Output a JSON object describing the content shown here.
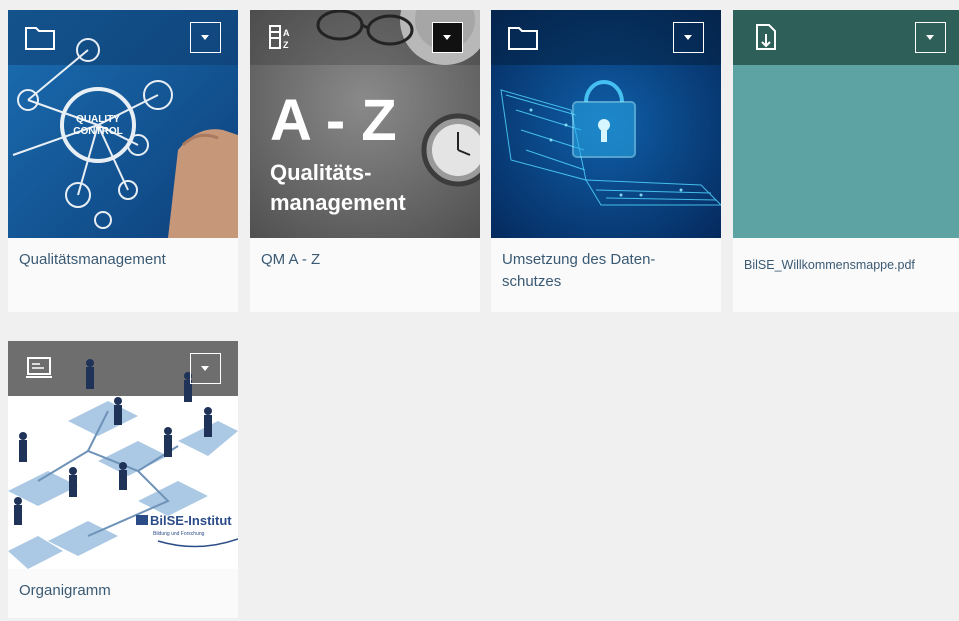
{
  "tiles": [
    {
      "title": "Qualitätsmanagement",
      "type_icon": "folder-icon",
      "image_text": [
        "QUALITY",
        "CONTROL"
      ]
    },
    {
      "title": "QM A - Z",
      "type_icon": "sort-a-z-icon",
      "image_text": [
        "A - Z",
        "Qualitäts-",
        "management"
      ]
    },
    {
      "title": "Umsetzung des Daten- schutzes",
      "type_icon": "folder-icon"
    },
    {
      "title": "BilSE_Willkommensmappe.pdf",
      "type_icon": "file-download-icon"
    },
    {
      "title": "Organigramm",
      "type_icon": "presentation-icon",
      "image_text": [
        "BilSE-Institut",
        "Bildung und Forschung"
      ]
    }
  ],
  "colors": {
    "tile_title": "#3a5a74",
    "teal_tile": "#5ea3a4",
    "teal_tile_bar": "#2e5f58",
    "page_bg": "#f0f0f0"
  }
}
